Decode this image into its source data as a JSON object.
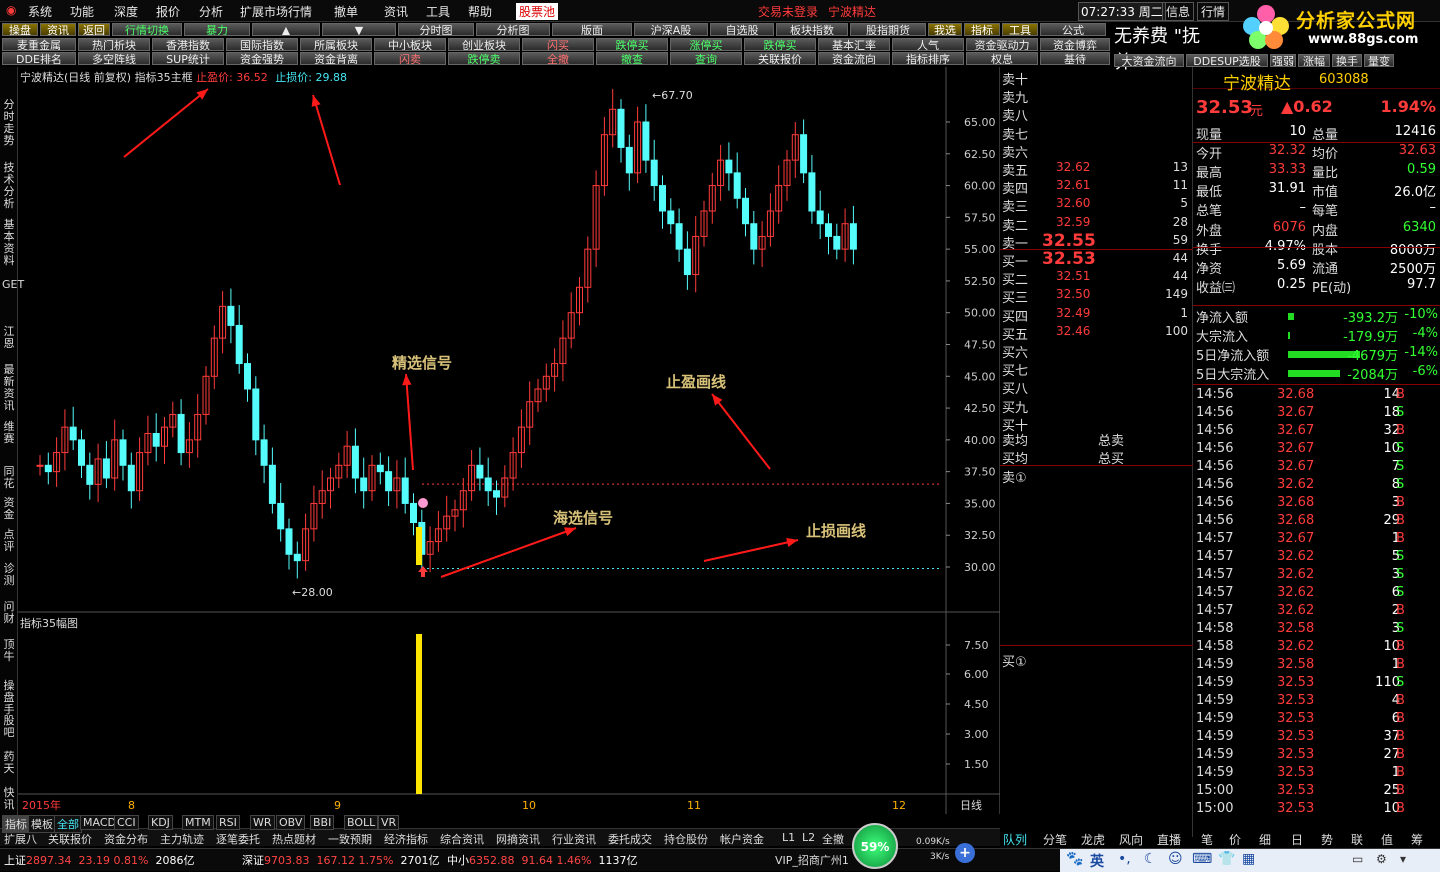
{
  "menubar": {
    "items": [
      "系统",
      "功能",
      "深度",
      "报价",
      "分析",
      "扩展市场行情",
      "撤单",
      "资讯",
      "工具",
      "帮助",
      "股票池"
    ],
    "status": "交易未登录",
    "stock_title": "宁波精达",
    "clock": "07:27:33",
    "weekday": "周二",
    "right_buttons": [
      "信息",
      "行情"
    ]
  },
  "toolbar": {
    "row1": [
      "操盘",
      "资讯",
      "返回",
      "行情切换",
      "暴力",
      "▲",
      "▼",
      "分时图",
      "分析图",
      "版面",
      "沪深A股",
      "自选股",
      "板块指数",
      "股指期货",
      "我选",
      "指标",
      "工具",
      "公式"
    ],
    "row2": [
      "麦重金属",
      "热门析块",
      "香港指数",
      "国际指数",
      "所属板块",
      "中小板块",
      "创业板块",
      "闪买",
      "跌停买",
      "涨停买",
      "跌停买",
      "基本汇率",
      "人气",
      "资金驱动力",
      "资金博弈"
    ],
    "row3": [
      "DDE排名",
      "多空阵线",
      "SUP统计",
      "资金强势",
      "资金背离",
      "闪卖",
      "跌停卖",
      "全撤",
      "撤查",
      "查询",
      "关联报价",
      "资金流向",
      "指标排序",
      "权息",
      "基待"
    ],
    "advert": "无养费 \"抚养\"",
    "row_right": [
      "大资金流向",
      "DDESUP选股",
      "强弱",
      "涨幅",
      "换手",
      "量变"
    ]
  },
  "logo": {
    "title": "分析家公式网",
    "url": "www.88gs.com"
  },
  "leftrail": [
    "分时走势",
    "技术分析",
    "基本资料",
    "GET",
    "江恩",
    "最新资讯",
    "维赛",
    "同花",
    "资金",
    "点评",
    "诊测",
    "问财",
    "顶牛",
    "操盘手",
    "股吧",
    "药天",
    "快讯"
  ],
  "chart": {
    "title": "宁波精达(日线 前复权) 指标35主框",
    "take_profit_label": "止盈价:",
    "take_profit_value": "36.52",
    "stop_loss_label": "止损价:",
    "stop_loss_value": "29.88",
    "high_label": "67.70",
    "low_label": "28.00",
    "annotations": {
      "selected_signal": "精选信号",
      "sea_signal": "海选信号",
      "tp_line": "止盈画线",
      "sl_line": "止损画线"
    },
    "sub_title": "指标35幅图",
    "period": "日线",
    "date_labels": [
      "2015年",
      "8",
      "9",
      "10",
      "11",
      "12"
    ]
  },
  "chart_data": {
    "type": "candlestick",
    "y_ticks": [
      "65.00",
      "62.50",
      "60.00",
      "57.50",
      "55.00",
      "52.50",
      "50.00",
      "47.50",
      "45.00",
      "42.50",
      "40.00",
      "37.50",
      "35.00",
      "32.50",
      "30.00"
    ],
    "sub_y_ticks": [
      "7.50",
      "6.00",
      "4.50",
      "3.00",
      "1.50"
    ],
    "take_profit": 36.52,
    "stop_loss": 29.88,
    "high": 67.7,
    "low": 28.0,
    "signal_bar_value": 9.0
  },
  "tabs_bottom": [
    "指标",
    "模板",
    "全部",
    "MACD",
    "CCI",
    "KDJ",
    "MTM",
    "RSI",
    "WR",
    "OBV",
    "BBI",
    "BOLL",
    "VR"
  ],
  "bottom_menu": [
    "扩展八",
    "关联报价",
    "资金分布",
    "主力轨迹",
    "逐笔委托",
    "热点题材",
    "一致预期",
    "经济指标",
    "综合资讯",
    "网摘资讯",
    "行业资讯",
    "委托成交",
    "持仓股份",
    "帐户资金",
    "L1",
    "L2",
    "全撤"
  ],
  "orderbook": {
    "sell": [
      {
        "label": "卖十",
        "price": "",
        "vol": ""
      },
      {
        "label": "卖九",
        "price": "",
        "vol": ""
      },
      {
        "label": "卖八",
        "price": "",
        "vol": ""
      },
      {
        "label": "卖七",
        "price": "",
        "vol": ""
      },
      {
        "label": "卖六",
        "price": "",
        "vol": ""
      },
      {
        "label": "卖五",
        "price": "32.62",
        "vol": "13"
      },
      {
        "label": "卖四",
        "price": "32.61",
        "vol": "11"
      },
      {
        "label": "卖三",
        "price": "32.60",
        "vol": "5"
      },
      {
        "label": "卖二",
        "price": "32.59",
        "vol": "28"
      },
      {
        "label": "卖一",
        "price": "32.55",
        "vol": "59"
      }
    ],
    "buy": [
      {
        "label": "买一",
        "price": "32.53",
        "vol": "44"
      },
      {
        "label": "买二",
        "price": "32.51",
        "vol": "44"
      },
      {
        "label": "买三",
        "price": "32.50",
        "vol": "149"
      },
      {
        "label": "买四",
        "price": "32.49",
        "vol": "1"
      },
      {
        "label": "买五",
        "price": "32.46",
        "vol": "100"
      },
      {
        "label": "买六",
        "price": "",
        "vol": ""
      },
      {
        "label": "买七",
        "price": "",
        "vol": ""
      },
      {
        "label": "买八",
        "price": "",
        "vol": ""
      },
      {
        "label": "买九",
        "price": "",
        "vol": ""
      },
      {
        "label": "买十",
        "price": "",
        "vol": ""
      }
    ],
    "avg_sell": "卖均",
    "avg_buy": "买均",
    "total_sell": "总卖",
    "total_buy": "总买",
    "sell1": "卖①",
    "buy1": "买①"
  },
  "quote": {
    "name": "宁波精达",
    "code": "603088",
    "price": "32.53",
    "unit": "元",
    "change": "▲0.62",
    "pct": "1.94%",
    "rows": [
      [
        "现量",
        "10",
        "总量",
        "12416"
      ],
      [
        "今开",
        "32.32",
        "均价",
        "32.63"
      ],
      [
        "最高",
        "33.33",
        "量比",
        "0.59"
      ],
      [
        "最低",
        "31.91",
        "市值",
        "26.0亿"
      ],
      [
        "总笔",
        "–",
        "每笔",
        "–"
      ],
      [
        "外盘",
        "6076",
        "内盘",
        "6340"
      ],
      [
        "换手",
        "4.97%",
        "股本",
        "8000万"
      ],
      [
        "净资",
        "5.69",
        "流通",
        "2500万"
      ],
      [
        "收益㈢",
        "0.25",
        "PE(动)",
        "97.7"
      ]
    ],
    "flows": [
      [
        "净流入额",
        "-393.2万",
        "-10%"
      ],
      [
        "大宗流入",
        "-179.9万",
        "-4%"
      ],
      [
        "5日净流入额",
        "-4679万",
        "-14%"
      ],
      [
        "5日大宗流入",
        "-2084万",
        "-6%"
      ]
    ]
  },
  "ticks": [
    [
      "14:56",
      "32.68",
      "14",
      "B"
    ],
    [
      "14:56",
      "32.67",
      "18",
      "S"
    ],
    [
      "14:56",
      "32.67",
      "32",
      "B"
    ],
    [
      "14:56",
      "32.67",
      "10",
      "S"
    ],
    [
      "14:56",
      "32.67",
      "7",
      "S"
    ],
    [
      "14:56",
      "32.62",
      "8",
      "S"
    ],
    [
      "14:56",
      "32.68",
      "3",
      "B"
    ],
    [
      "14:56",
      "32.68",
      "29",
      "B"
    ],
    [
      "14:57",
      "32.67",
      "1",
      "B"
    ],
    [
      "14:57",
      "32.62",
      "5",
      "S"
    ],
    [
      "14:57",
      "32.62",
      "3",
      "S"
    ],
    [
      "14:57",
      "32.62",
      "6",
      "S"
    ],
    [
      "14:57",
      "32.62",
      "2",
      "B"
    ],
    [
      "14:58",
      "32.58",
      "3",
      "S"
    ],
    [
      "14:58",
      "32.62",
      "10",
      "B"
    ],
    [
      "14:59",
      "32.58",
      "1",
      "B"
    ],
    [
      "14:59",
      "32.53",
      "110",
      "S"
    ],
    [
      "14:59",
      "32.53",
      "4",
      "B"
    ],
    [
      "14:59",
      "32.53",
      "6",
      "B"
    ],
    [
      "14:59",
      "32.53",
      "37",
      "B"
    ],
    [
      "14:59",
      "32.53",
      "27",
      "B"
    ],
    [
      "14:59",
      "32.53",
      "1",
      "B"
    ],
    [
      "15:00",
      "32.53",
      "25",
      "B"
    ],
    [
      "15:00",
      "32.53",
      "10",
      "B"
    ]
  ],
  "right_tabs": [
    "队列",
    "分笔",
    "龙虎",
    "风向",
    "直播",
    "笔",
    "价",
    "细",
    "日",
    "势",
    "联",
    "值",
    "筹"
  ],
  "statusbar": {
    "sh_label": "上证",
    "sh_val": "2897.34",
    "sh_chg": "23.19",
    "sh_pct": "0.81%",
    "sh_amt": "2086亿",
    "sz_label": "深证",
    "sz_val": "9703.83",
    "sz_chg": "167.12",
    "sz_pct": "1.75%",
    "sz_amt": "2701亿",
    "zx_label": "中小",
    "zx_val": "6352.88",
    "zx_chg": "91.64",
    "zx_pct": "1.46%",
    "zx_amt": "1137亿",
    "vip": "VIP_招商广州1",
    "speed_pct": "59%",
    "up": "0.09K/s",
    "down": "3K/s",
    "ime": "英"
  },
  "colors": {
    "up": "#ff3333",
    "down": "#33ff33",
    "cyan_bar": "#54fcfc",
    "accent": "#ffd000"
  }
}
